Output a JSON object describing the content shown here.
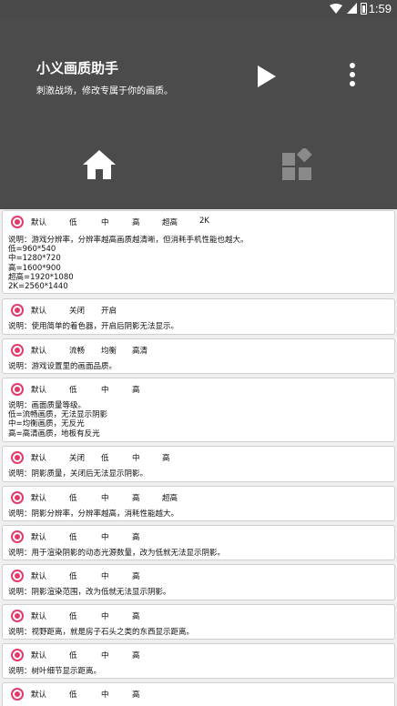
{
  "status_bar": {
    "time": "1:59"
  },
  "header": {
    "title": "小义画质助手",
    "subtitle": "刺激战场，修改专属于你的画质。"
  },
  "tabs": [
    "home",
    "widgets"
  ],
  "cards": [
    {
      "options": [
        "默认",
        "低",
        "中",
        "高",
        "超高",
        "2K"
      ],
      "description": "说明：游戏分辨率，分辨率越高画质越清晰，但消耗手机性能也越大。\n低=960*540\n中=1280*720\n高=1600*900\n超高=1920*1080\n2K=2560*1440"
    },
    {
      "options": [
        "默认",
        "关闭",
        "开启"
      ],
      "description": "说明：使用简单的着色器，开启后阴影无法显示。"
    },
    {
      "options": [
        "默认",
        "流畅",
        "均衡",
        "高清"
      ],
      "description": "说明：游戏设置里的画面品质。"
    },
    {
      "options": [
        "默认",
        "低",
        "中",
        "高"
      ],
      "description": "说明：画面质量等级。\n低=流畅画质，无法显示阴影\n中=均衡画质，无反光\n高=高清画质，地板有反光"
    },
    {
      "options": [
        "默认",
        "关闭",
        "低",
        "中",
        "高"
      ],
      "description": "说明：阴影质量，关闭后无法显示阴影。"
    },
    {
      "options": [
        "默认",
        "低",
        "中",
        "高",
        "超高"
      ],
      "description": "说明：阴影分辨率，分辨率越高，消耗性能越大。"
    },
    {
      "options": [
        "默认",
        "低",
        "中",
        "高"
      ],
      "description": "说明：用于渲染阴影的动态光源数量，改为低就无法显示阴影。"
    },
    {
      "options": [
        "默认",
        "低",
        "中",
        "高"
      ],
      "description": "说明：阴影渲染范围，改为低就无法显示阴影。"
    },
    {
      "options": [
        "默认",
        "低",
        "中",
        "高"
      ],
      "description": "说明：视野距离，就是房子石头之类的东西显示距离。"
    },
    {
      "options": [
        "默认",
        "低",
        "中",
        "高"
      ],
      "description": "说明：树叶细节显示距离。"
    },
    {
      "options": [
        "默认",
        "低",
        "中",
        "高"
      ],
      "description": ""
    }
  ],
  "colors": {
    "header_bg": "#4b4b4b",
    "accent": "#e23b6a",
    "page_bg": "#efefef"
  }
}
